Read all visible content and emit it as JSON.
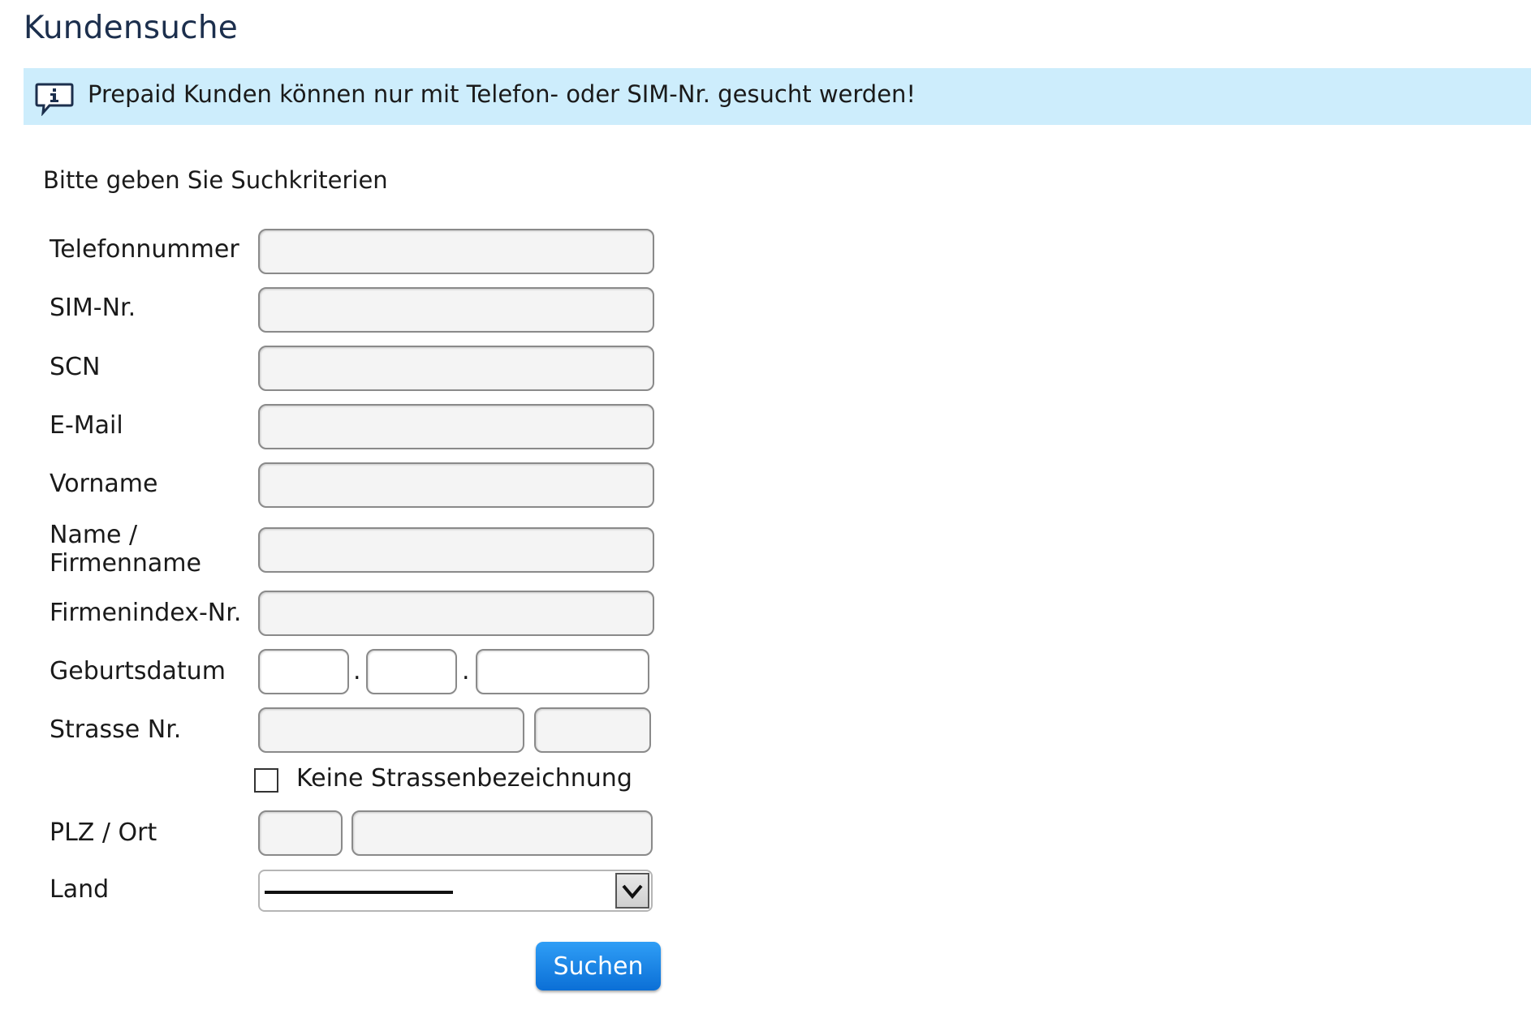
{
  "page": {
    "title": "Kundensuche",
    "info_message": "Prepaid Kunden können nur mit Telefon- oder SIM-Nr. gesucht werden!",
    "info_icon": "info-speech-bubble-icon",
    "instruction": "Bitte geben Sie Suchkriterien"
  },
  "form": {
    "phone_label": "Telefonnummer",
    "phone_value": "",
    "sim_label": "SIM-Nr.",
    "sim_value": "",
    "scn_label": "SCN",
    "scn_value": "",
    "email_label": "E-Mail",
    "email_value": "",
    "firstname_label": "Vorname",
    "firstname_value": "",
    "name_label_line1": "Name /",
    "name_label_line2": "Firmenname",
    "name_value": "",
    "company_index_label": "Firmenindex-Nr.",
    "company_index_value": "",
    "birthdate_label": "Geburtsdatum",
    "birthdate_separator": ".",
    "birthdate_day": "",
    "birthdate_month": "",
    "birthdate_year": "",
    "street_label": "Strasse Nr.",
    "street_value": "",
    "house_number_value": "",
    "no_street_label": "Keine Strassenbezeichnung",
    "no_street_checked": false,
    "zip_city_label": "PLZ / Ort",
    "zip_value": "",
    "city_value": "",
    "country_label": "Land",
    "country_selected": "",
    "search_button_label": "Suchen"
  },
  "colors": {
    "banner_background": "#cdedfc",
    "title_color": "#1c2f4d",
    "button_color": "#1a86e8"
  }
}
